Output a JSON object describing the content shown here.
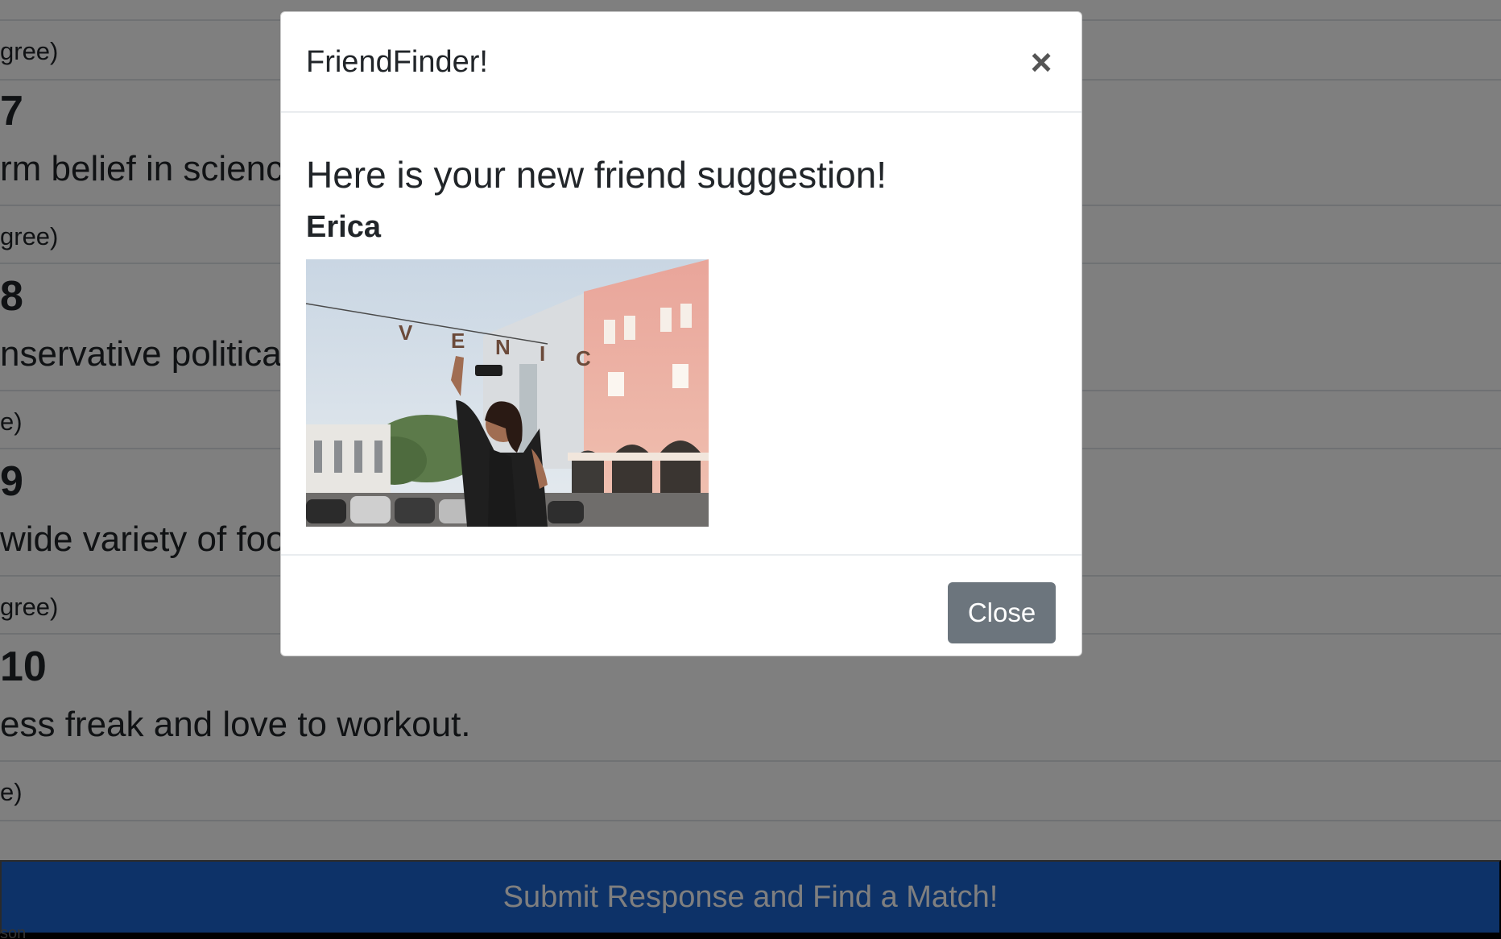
{
  "survey": {
    "rows": [
      {
        "type": "answer",
        "text": "gree)"
      },
      {
        "type": "num",
        "text": "7"
      },
      {
        "type": "text",
        "text": "rm belief in scienc"
      },
      {
        "type": "answer",
        "text": "gree)"
      },
      {
        "type": "num",
        "text": "8"
      },
      {
        "type": "text",
        "text": "nservative politica"
      },
      {
        "type": "answer",
        "text": "e)"
      },
      {
        "type": "num",
        "text": "9"
      },
      {
        "type": "text",
        "text": "wide variety of foo"
      },
      {
        "type": "answer",
        "text": "gree)"
      },
      {
        "type": "num",
        "text": "10"
      },
      {
        "type": "text",
        "text": "ess freak and love to workout."
      },
      {
        "type": "answer",
        "text": "e)"
      }
    ],
    "submit_label": "Submit Response and Find a Match!",
    "footer_fragment": "son"
  },
  "modal": {
    "title": "FriendFinder!",
    "close_icon": "×",
    "heading": "Here is your new friend suggestion!",
    "friend_name": "Erica",
    "photo_sign_letters": [
      "V",
      "E",
      "N",
      "I",
      "C"
    ],
    "close_button_label": "Close"
  },
  "colors": {
    "submit_blue": "#1a64d0",
    "close_button_gray": "#6c757d",
    "backdrop": "rgba(0,0,0,0.5)"
  }
}
